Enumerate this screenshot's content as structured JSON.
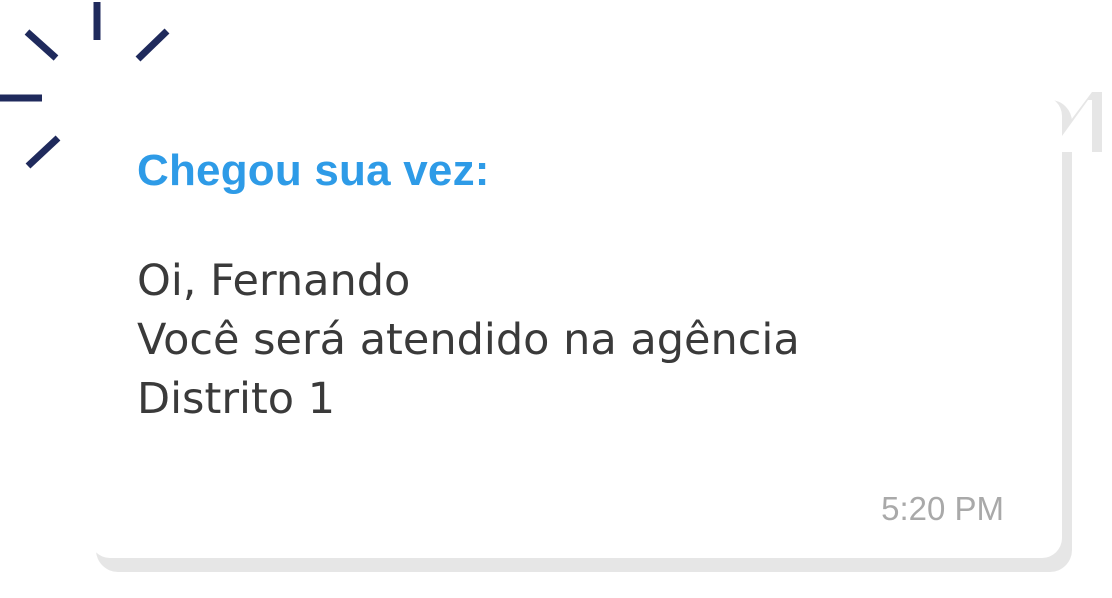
{
  "notification": {
    "title": "Chegou sua vez:",
    "lines": [
      "Oi, Fernando",
      "Você será atendido na agência",
      "Distrito 1"
    ],
    "timestamp": "5:20 PM"
  },
  "colors": {
    "title": "#2e9be7",
    "body_text": "#3a3a3a",
    "timestamp": "#a9a9a9",
    "burst": "#1f2a5c",
    "bubble": "#ffffff",
    "bubble_shadow": "#e6e6e6"
  },
  "icons": {
    "burst": "attention-burst-icon"
  }
}
